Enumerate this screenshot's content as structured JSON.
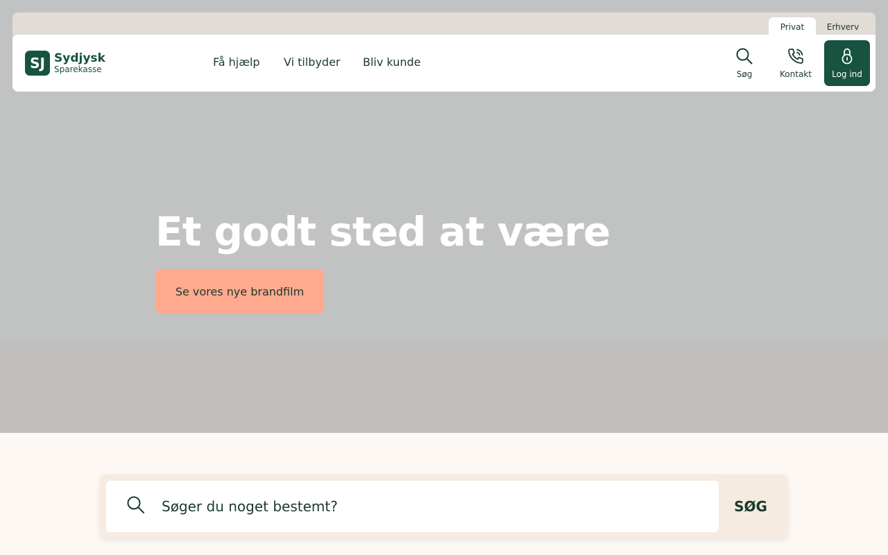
{
  "segments": {
    "privat": "Privat",
    "erhverv": "Erhverv"
  },
  "logo": {
    "mark": "SJ",
    "line1": "Sydjysk",
    "line2": "Sparekasse"
  },
  "nav": {
    "items": [
      {
        "label": "Få hjælp"
      },
      {
        "label": "Vi tilbyder"
      },
      {
        "label": "Bliv kunde"
      }
    ]
  },
  "tools": {
    "search": "Søg",
    "contact": "Kontakt",
    "login": "Log ind"
  },
  "hero": {
    "title": "Et godt sted at være",
    "button": "Se vores nye brandfilm"
  },
  "search": {
    "placeholder": "Søger du noget bestemt?",
    "button": "SØG"
  },
  "colors": {
    "brand": "#17533e",
    "accent": "#ffa98f",
    "hero_bg": "#c1c3c2",
    "page_bg": "#fdf8f4"
  }
}
